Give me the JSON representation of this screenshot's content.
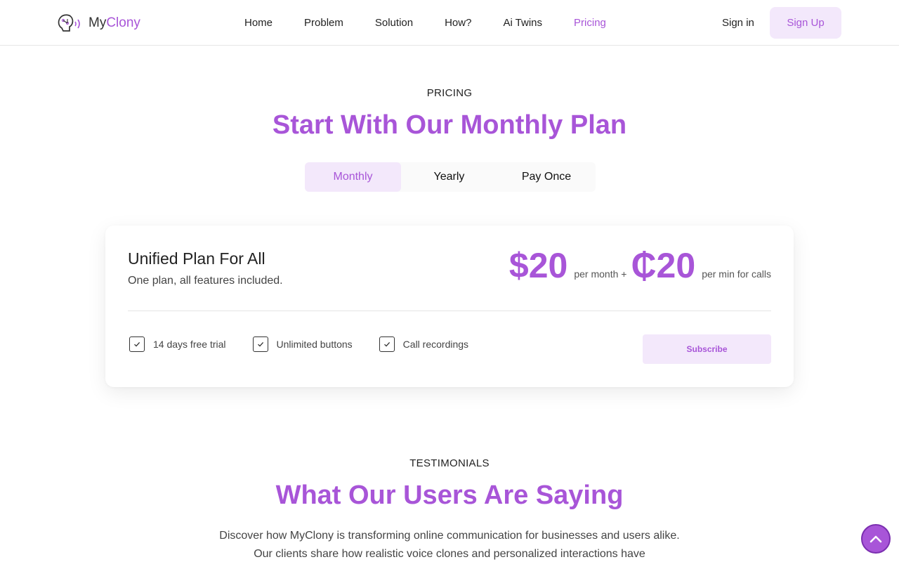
{
  "brand": {
    "name_part1": "My",
    "name_part2": "Clony",
    "accent": "#a855d8"
  },
  "nav": {
    "items": [
      {
        "label": "Home",
        "active": false
      },
      {
        "label": "Problem",
        "active": false
      },
      {
        "label": "Solution",
        "active": false
      },
      {
        "label": "How?",
        "active": false
      },
      {
        "label": "Ai Twins",
        "active": false
      },
      {
        "label": "Pricing",
        "active": true
      }
    ],
    "sign_in": "Sign in",
    "sign_up": "Sign Up"
  },
  "pricing": {
    "eyebrow": "PRICING",
    "title": "Start With Our Monthly Plan",
    "tabs": [
      {
        "label": "Monthly",
        "active": true
      },
      {
        "label": "Yearly",
        "active": false
      },
      {
        "label": "Pay Once",
        "active": false
      }
    ],
    "plan": {
      "title": "Unified Plan For All",
      "subtitle": "One plan, all features included.",
      "price_main": "$20",
      "price_main_note": "per month +",
      "price_call": "₵20",
      "price_call_note": "per min for calls",
      "features": [
        "14 days free trial",
        "Unlimited buttons",
        "Call recordings"
      ],
      "cta": "Subscribe"
    }
  },
  "testimonials": {
    "eyebrow": "TESTIMONIALS",
    "title": "What Our Users Are Saying",
    "intro": "Discover how MyClony is transforming online communication for businesses and users alike. Our clients share how realistic voice clones and personalized interactions have"
  },
  "icons": {
    "logo": "head-voice-logo-icon",
    "check": "check-icon",
    "scroll_top": "chevron-up-icon"
  }
}
